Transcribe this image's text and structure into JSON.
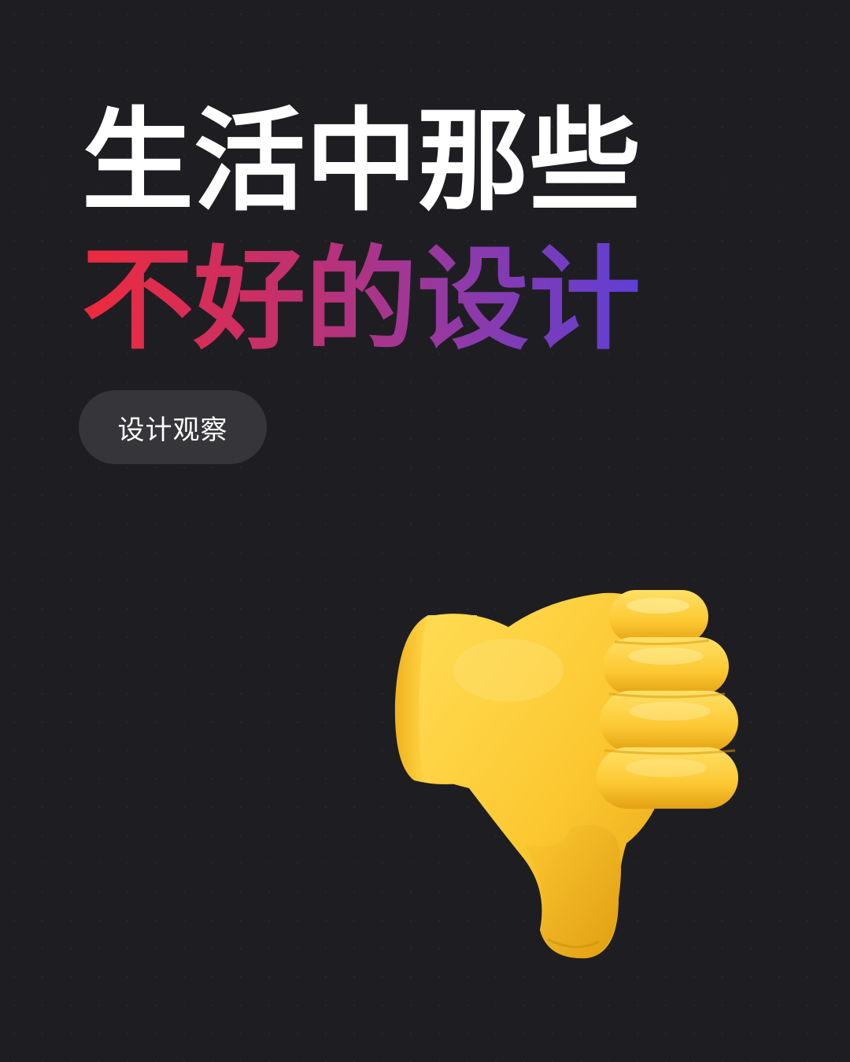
{
  "headline": {
    "line1": "生活中那些",
    "line2": "不好的设计"
  },
  "tag": {
    "label": "设计观察"
  },
  "illustration": {
    "icon": "thumbs-down-icon",
    "colors": {
      "skin_light": "#ffd84a",
      "skin_mid": "#f7c12a",
      "skin_dark": "#d99a0f"
    }
  },
  "colors": {
    "background": "#1e1e22",
    "headline_primary": "#ffffff",
    "gradient": [
      "#ee2a3c",
      "#c2306e",
      "#8f3aa8",
      "#5e3fd6"
    ],
    "tag_background": "#35353a"
  }
}
